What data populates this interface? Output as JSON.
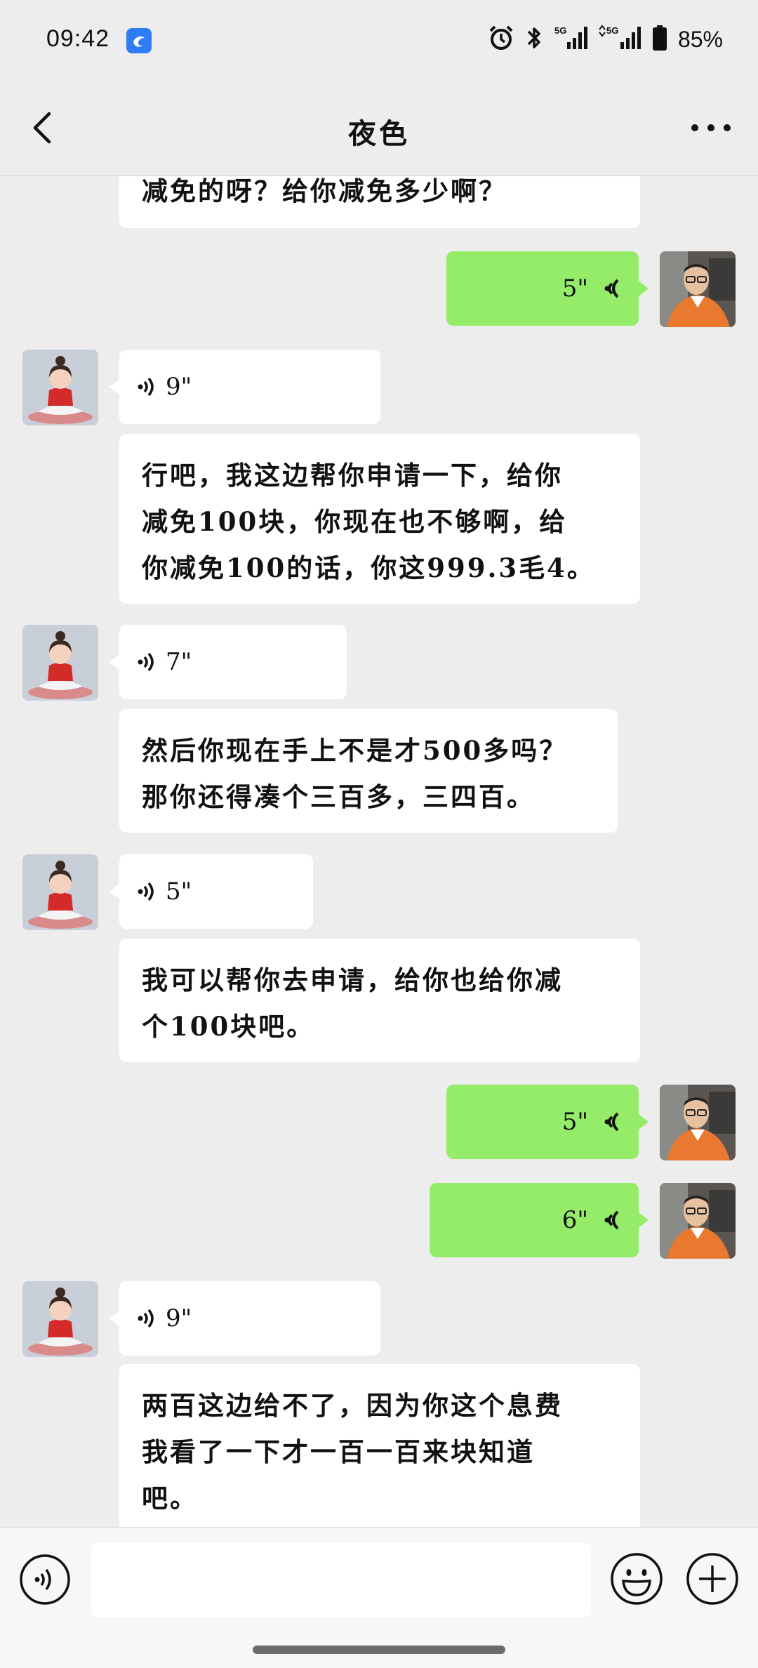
{
  "status_bar": {
    "time": "09:42",
    "battery": "85%",
    "signal_1": "5G",
    "signal_2": "5G"
  },
  "header": {
    "title": "夜色"
  },
  "messages": [
    {
      "side": "in",
      "type": "text",
      "text": "减免的呀？给你减免多少啊？"
    },
    {
      "side": "out",
      "type": "voice",
      "duration": "5\""
    },
    {
      "side": "in",
      "type": "voice",
      "duration": "9\""
    },
    {
      "side": "in",
      "type": "text",
      "lines": [
        "行吧，我这边帮你申请一下，给你",
        "减免100块，你现在也不够啊，给",
        "你减免100的话，你这999.3毛4。"
      ]
    },
    {
      "side": "in",
      "type": "voice",
      "duration": "7\""
    },
    {
      "side": "in",
      "type": "text",
      "lines": [
        "然后你现在手上不是才500多吗？",
        "那你还得凑个三百多，三四百。"
      ]
    },
    {
      "side": "in",
      "type": "voice",
      "duration": "5\""
    },
    {
      "side": "in",
      "type": "text",
      "lines": [
        "我可以帮你去申请，给你也给你减",
        "个100块吧。"
      ]
    },
    {
      "side": "out",
      "type": "voice",
      "duration": "5\""
    },
    {
      "side": "out",
      "type": "voice",
      "duration": "6\""
    },
    {
      "side": "in",
      "type": "voice",
      "duration": "9\""
    },
    {
      "side": "in",
      "type": "text",
      "lines": [
        "两百这边给不了，因为你这个息费",
        "我看了一下才一百一百来块知道",
        "吧。"
      ]
    }
  ],
  "colors": {
    "background": "#ededed",
    "outgoing_bubble": "#95ec69",
    "incoming_bubble": "#ffffff"
  },
  "icons": {
    "back": "chevron-left-icon",
    "more": "more-dots-icon",
    "voice_toggle": "voice-icon",
    "emoji": "emoji-icon",
    "plus": "plus-icon"
  }
}
